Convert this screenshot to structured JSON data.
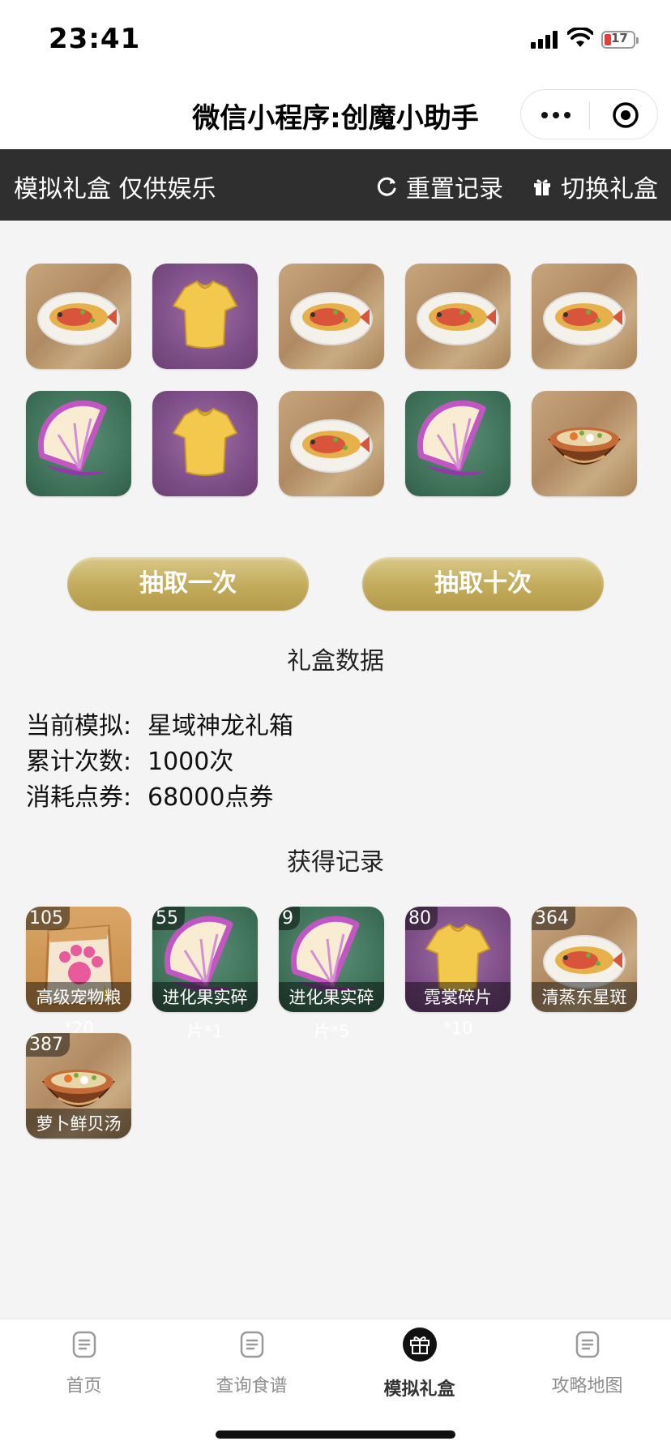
{
  "status_bar": {
    "time": "23:41",
    "battery": "17"
  },
  "title_bar": {
    "title": "微信小程序:创魔小助手"
  },
  "header": {
    "title": "模拟礼盒 仅供娱乐",
    "reset_label": "重置记录",
    "switch_label": "切换礼盒"
  },
  "draw_results": [
    {
      "item": "fish-dish"
    },
    {
      "item": "shirt-fragment"
    },
    {
      "item": "fish-dish"
    },
    {
      "item": "fish-dish"
    },
    {
      "item": "fish-dish"
    },
    {
      "item": "evolution-fruit"
    },
    {
      "item": "shirt-fragment"
    },
    {
      "item": "fish-dish"
    },
    {
      "item": "evolution-fruit"
    },
    {
      "item": "soup-bowl"
    }
  ],
  "buttons": {
    "draw_once": "抽取一次",
    "draw_ten": "抽取十次"
  },
  "stats": {
    "title": "礼盒数据",
    "current_label": "当前模拟:",
    "current_value": "星域神龙礼箱",
    "count_label": "累计次数:",
    "count_value": "1000次",
    "cost_label": "消耗点券:",
    "cost_value": "68000点券"
  },
  "records": {
    "title": "获得记录",
    "items": [
      {
        "count": "105",
        "name": "高级宠物粮",
        "overflow": "*20",
        "icon": "pet-food-bag-icon"
      },
      {
        "count": "55",
        "name": "进化果实碎",
        "overflow": "片*1",
        "icon": "evolution-fruit-icon"
      },
      {
        "count": "9",
        "name": "进化果实碎",
        "overflow": "片*5",
        "icon": "evolution-fruit-icon"
      },
      {
        "count": "80",
        "name": "霓裳碎片",
        "overflow": "*10",
        "icon": "shirt-fragment-icon"
      },
      {
        "count": "364",
        "name": "清蒸东星斑",
        "overflow": "",
        "icon": "fish-dish-icon"
      },
      {
        "count": "387",
        "name": "萝卜鲜贝汤",
        "overflow": "",
        "icon": "soup-bowl-icon"
      }
    ]
  },
  "tabs": [
    {
      "label": "首页"
    },
    {
      "label": "查询食谱"
    },
    {
      "label": "模拟礼盒"
    },
    {
      "label": "攻略地图"
    }
  ],
  "colors": {
    "header_bg": "#2f2f2f",
    "button_gold": "#c4ad5e",
    "page_bg": "#f4f4f4"
  }
}
